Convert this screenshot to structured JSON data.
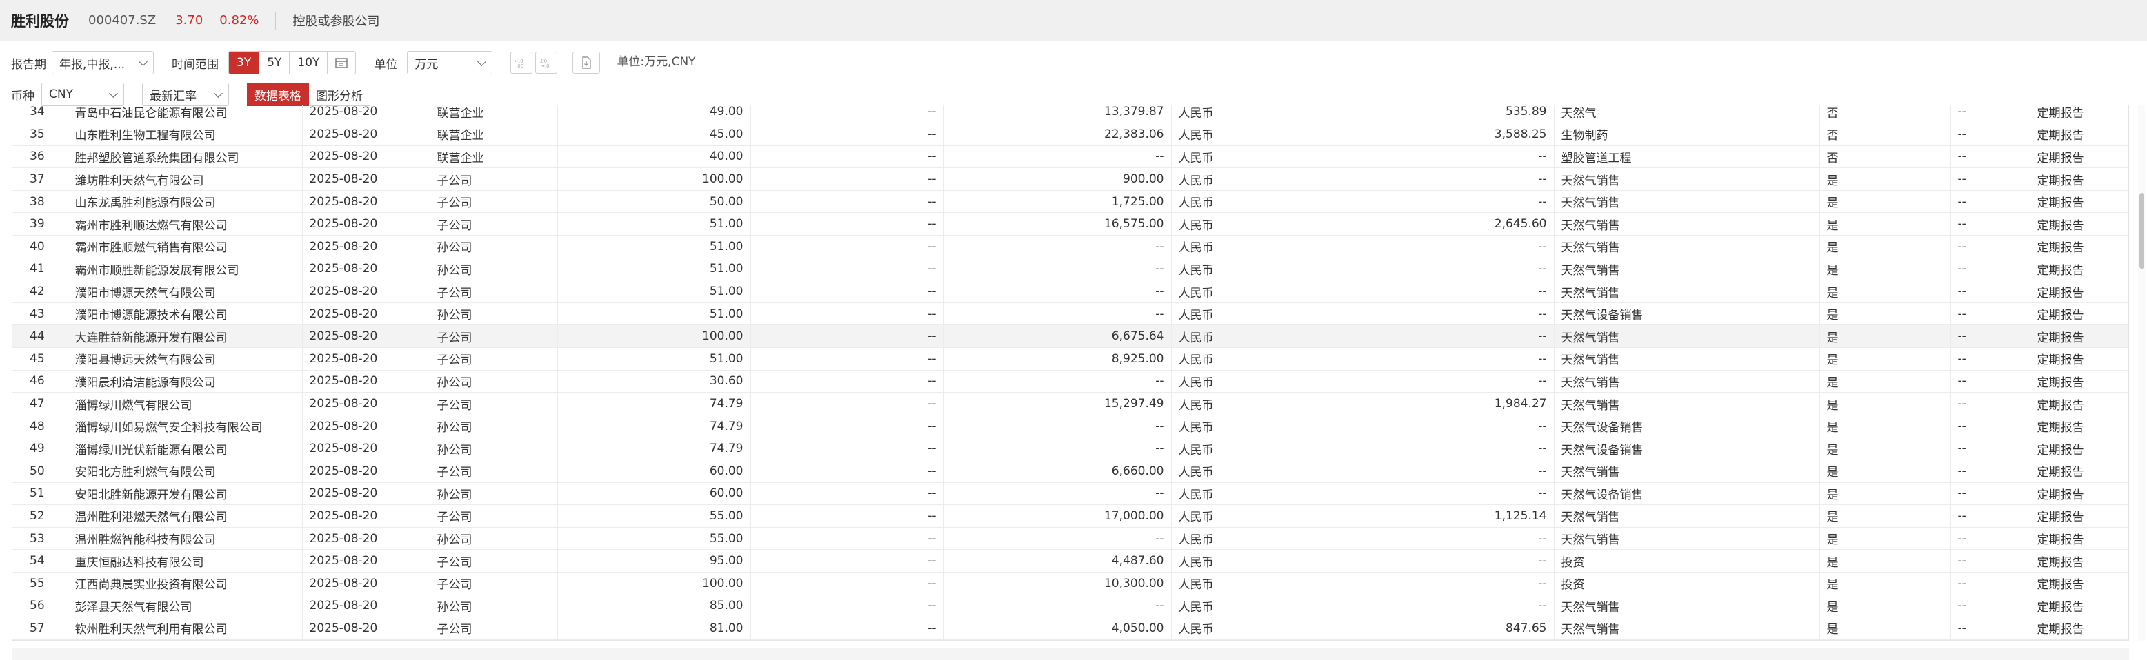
{
  "header": {
    "title": "胜利股份",
    "code": "000407.SZ",
    "price": "3.70",
    "change_pct": "0.82%",
    "menu": "控股或参股公司"
  },
  "toolbar": {
    "report_period_label": "报告期",
    "report_period_value": "年报,中报,...",
    "time_range_label": "时间范围",
    "time_range_options": [
      "3Y",
      "5Y",
      "10Y"
    ],
    "time_range_selected": "3Y",
    "unit_label": "单位",
    "unit_value": "万元",
    "unit_note": "单位:万元,CNY",
    "currency_label": "币种",
    "currency_value": "CNY",
    "rate_value": "最新汇率",
    "view_tabs": [
      "数据表格",
      "图形分析"
    ],
    "view_selected": "数据表格"
  },
  "table": {
    "rows": [
      [
        "34",
        "青岛中石油昆仑能源有限公司",
        "2025-08-20",
        "联营企业",
        "49.00",
        "--",
        "13,379.87",
        "人民币",
        "535.89",
        "天然气",
        "否",
        "--",
        "定期报告"
      ],
      [
        "35",
        "山东胜利生物工程有限公司",
        "2025-08-20",
        "联营企业",
        "45.00",
        "--",
        "22,383.06",
        "人民币",
        "3,588.25",
        "生物制药",
        "否",
        "--",
        "定期报告"
      ],
      [
        "36",
        "胜邦塑胶管道系统集团有限公司",
        "2025-08-20",
        "联营企业",
        "40.00",
        "--",
        "--",
        "人民币",
        "--",
        "塑胶管道工程",
        "否",
        "--",
        "定期报告"
      ],
      [
        "37",
        "潍坊胜利天然气有限公司",
        "2025-08-20",
        "子公司",
        "100.00",
        "--",
        "900.00",
        "人民币",
        "--",
        "天然气销售",
        "是",
        "--",
        "定期报告"
      ],
      [
        "38",
        "山东龙禹胜利能源有限公司",
        "2025-08-20",
        "子公司",
        "50.00",
        "--",
        "1,725.00",
        "人民币",
        "--",
        "天然气销售",
        "是",
        "--",
        "定期报告"
      ],
      [
        "39",
        "霸州市胜利顺达燃气有限公司",
        "2025-08-20",
        "子公司",
        "51.00",
        "--",
        "16,575.00",
        "人民币",
        "2,645.60",
        "天然气销售",
        "是",
        "--",
        "定期报告"
      ],
      [
        "40",
        "霸州市胜顺燃气销售有限公司",
        "2025-08-20",
        "孙公司",
        "51.00",
        "--",
        "--",
        "人民币",
        "--",
        "天然气销售",
        "是",
        "--",
        "定期报告"
      ],
      [
        "41",
        "霸州市顺胜新能源发展有限公司",
        "2025-08-20",
        "孙公司",
        "51.00",
        "--",
        "--",
        "人民币",
        "--",
        "天然气销售",
        "是",
        "--",
        "定期报告"
      ],
      [
        "42",
        "濮阳市博源天然气有限公司",
        "2025-08-20",
        "子公司",
        "51.00",
        "--",
        "--",
        "人民币",
        "--",
        "天然气销售",
        "是",
        "--",
        "定期报告"
      ],
      [
        "43",
        "濮阳市博源能源技术有限公司",
        "2025-08-20",
        "孙公司",
        "51.00",
        "--",
        "--",
        "人民币",
        "--",
        "天然气设备销售",
        "是",
        "--",
        "定期报告"
      ],
      [
        "44",
        "大连胜益新能源开发有限公司",
        "2025-08-20",
        "子公司",
        "100.00",
        "--",
        "6,675.64",
        "人民币",
        "--",
        "天然气销售",
        "是",
        "--",
        "定期报告"
      ],
      [
        "45",
        "濮阳县博远天然气有限公司",
        "2025-08-20",
        "子公司",
        "51.00",
        "--",
        "8,925.00",
        "人民币",
        "--",
        "天然气销售",
        "是",
        "--",
        "定期报告"
      ],
      [
        "46",
        "濮阳晨利清洁能源有限公司",
        "2025-08-20",
        "孙公司",
        "30.60",
        "--",
        "--",
        "人民币",
        "--",
        "天然气销售",
        "是",
        "--",
        "定期报告"
      ],
      [
        "47",
        "淄博绿川燃气有限公司",
        "2025-08-20",
        "子公司",
        "74.79",
        "--",
        "15,297.49",
        "人民币",
        "1,984.27",
        "天然气销售",
        "是",
        "--",
        "定期报告"
      ],
      [
        "48",
        "淄博绿川如易燃气安全科技有限公司",
        "2025-08-20",
        "孙公司",
        "74.79",
        "--",
        "--",
        "人民币",
        "--",
        "天然气设备销售",
        "是",
        "--",
        "定期报告"
      ],
      [
        "49",
        "淄博绿川光伏新能源有限公司",
        "2025-08-20",
        "孙公司",
        "74.79",
        "--",
        "--",
        "人民币",
        "--",
        "天然气设备销售",
        "是",
        "--",
        "定期报告"
      ],
      [
        "50",
        "安阳北方胜利燃气有限公司",
        "2025-08-20",
        "子公司",
        "60.00",
        "--",
        "6,660.00",
        "人民币",
        "--",
        "天然气销售",
        "是",
        "--",
        "定期报告"
      ],
      [
        "51",
        "安阳北胜新能源开发有限公司",
        "2025-08-20",
        "孙公司",
        "60.00",
        "--",
        "--",
        "人民币",
        "--",
        "天然气设备销售",
        "是",
        "--",
        "定期报告"
      ],
      [
        "52",
        "温州胜利港燃天然气有限公司",
        "2025-08-20",
        "子公司",
        "55.00",
        "--",
        "17,000.00",
        "人民币",
        "1,125.14",
        "天然气销售",
        "是",
        "--",
        "定期报告"
      ],
      [
        "53",
        "温州胜燃智能科技有限公司",
        "2025-08-20",
        "孙公司",
        "55.00",
        "--",
        "--",
        "人民币",
        "--",
        "天然气销售",
        "是",
        "--",
        "定期报告"
      ],
      [
        "54",
        "重庆恒融达科技有限公司",
        "2025-08-20",
        "子公司",
        "95.00",
        "--",
        "4,487.60",
        "人民币",
        "--",
        "投资",
        "是",
        "--",
        "定期报告"
      ],
      [
        "55",
        "江西尚典晨实业投资有限公司",
        "2025-08-20",
        "子公司",
        "100.00",
        "--",
        "10,300.00",
        "人民币",
        "--",
        "投资",
        "是",
        "--",
        "定期报告"
      ],
      [
        "56",
        "彭泽县天然气有限公司",
        "2025-08-20",
        "孙公司",
        "85.00",
        "--",
        "--",
        "人民币",
        "--",
        "天然气销售",
        "是",
        "--",
        "定期报告"
      ],
      [
        "57",
        "钦州胜利天然气利用有限公司",
        "2025-08-20",
        "子公司",
        "81.00",
        "--",
        "4,050.00",
        "人民币",
        "847.65",
        "天然气销售",
        "是",
        "--",
        "定期报告"
      ]
    ],
    "highlighted_row": "44"
  }
}
